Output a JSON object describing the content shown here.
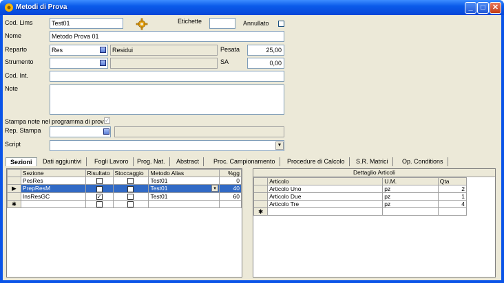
{
  "window": {
    "title": "Metodi di Prova"
  },
  "form": {
    "cod_lims_label": "Cod. Lims",
    "cod_lims_value": "Test01",
    "etichette_label": "Etichette",
    "etichette_value": "",
    "annullato_label": "Annullato",
    "nome_label": "Nome",
    "nome_value": "Metodo Prova 01",
    "reparto_label": "Reparto",
    "reparto_code": "Res",
    "reparto_desc": "Residui",
    "pesata_label": "Pesata",
    "pesata_value": "25,00",
    "strumento_label": "Strumento",
    "strumento_code": "",
    "strumento_desc": "",
    "sa_label": "SA",
    "sa_value": "0,00",
    "cod_int_label": "Cod. Int.",
    "cod_int_value": "",
    "note_label": "Note",
    "note_value": "",
    "stampa_note_label": "Stampa note nel programma di prova",
    "rep_stampa_label": "Rep. Stampa",
    "rep_stampa_value": "",
    "script_label": "Script",
    "script_value": ""
  },
  "tabs": [
    "Sezioni",
    "Dati aggiuntivi",
    "Fogli Lavoro",
    "Prog. Nat.",
    "Abstract",
    "Proc. Campionamento",
    "Procedure di Calcolo",
    "S.R. Matrici",
    "Op. Conditions"
  ],
  "sezioni": {
    "headers": [
      "Sezione",
      "Risultato",
      "Stoccaggio",
      "Metodo Alias",
      "%gg"
    ],
    "rows": [
      {
        "sezione": "PesRes",
        "metodo": "Test01",
        "gg": "0",
        "risultato": false,
        "stoccaggio": false
      },
      {
        "sezione": "PrepResM",
        "metodo": "Test01",
        "gg": "40",
        "risultato": false,
        "stoccaggio": false
      },
      {
        "sezione": "InsResGC",
        "metodo": "Test01",
        "gg": "60",
        "risultato": true,
        "stoccaggio": false
      }
    ],
    "new_row_marker": "✱",
    "current_row_marker": "▶"
  },
  "dettaglio": {
    "caption": "Dettaglio Articoli",
    "headers": [
      "Articolo",
      "U.M.",
      "Qta"
    ],
    "rows": [
      {
        "articolo": "Articolo Uno",
        "um": "pz",
        "qta": "2"
      },
      {
        "articolo": "Articolo Due",
        "um": "pz",
        "qta": "1"
      },
      {
        "articolo": "Articolo Tre",
        "um": "pz",
        "qta": "4"
      }
    ]
  }
}
